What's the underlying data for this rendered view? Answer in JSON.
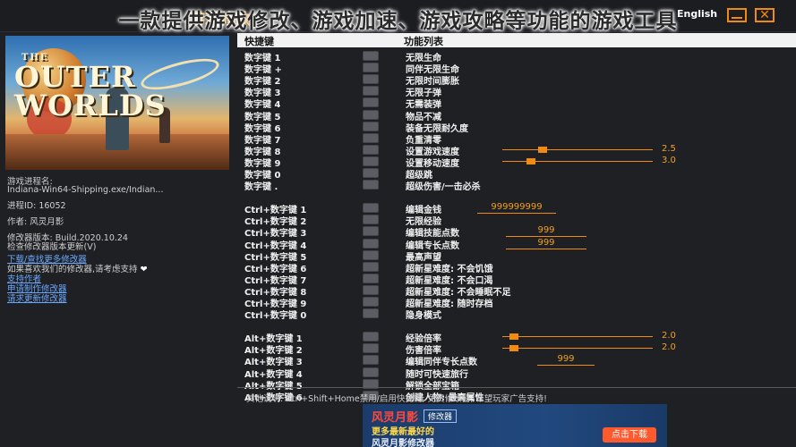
{
  "overlay_title": "一款提供游戏修改、游戏加速、游戏攻略等功能的游戏工具",
  "titlebar": {
    "app_title": "游戏修改",
    "language": "English"
  },
  "colors": {
    "accent": "#f08a10",
    "link": "#6aa9ff",
    "background": "#1f2024"
  },
  "left": {
    "cover_logo_small": "THE",
    "cover_logo_big": "OUTER WORLDS",
    "process_label": "游戏进程名:",
    "process_name": "Indiana-Win64-Shipping.exe/Indian...",
    "pid": "进程ID:  16052",
    "author": "作者:  风灵月影",
    "version": "修改器版本:  Build.2020.10.24",
    "check_update": "检查修改器版本更新(V)",
    "download_more": "下载/查找更多修改器",
    "support_text": "如果喜欢我们的修改器,请考虑支持",
    "support_link": "支持作者",
    "request": "申请制作修改器",
    "request_update": "请求更新修改器"
  },
  "table": {
    "header_key": "快捷键",
    "header_func": "功能列表",
    "rows": [
      {
        "key": "数字键 1",
        "func": "无限生命"
      },
      {
        "key": "数字键 +",
        "func": "同伴无限生命"
      },
      {
        "key": "数字键 2",
        "func": "无限时间膨胀"
      },
      {
        "key": "数字键 3",
        "func": "无限子弹"
      },
      {
        "key": "数字键 4",
        "func": "无需装弹"
      },
      {
        "key": "数字键 5",
        "func": "物品不减"
      },
      {
        "key": "数字键 6",
        "func": "装备无限耐久度"
      },
      {
        "key": "数字键 7",
        "func": "负重清零"
      },
      {
        "key": "数字键 8",
        "func": "设置游戏速度",
        "slider": 0.25,
        "value": "2.5"
      },
      {
        "key": "数字键 9",
        "func": "设置移动速度",
        "slider": 0.17,
        "value": "3.0"
      },
      {
        "key": "数字键 0",
        "func": "超级跳"
      },
      {
        "key": "数字键 .",
        "func": "超级伤害/一击必杀"
      },
      {
        "key": "Ctrl+数字键 1",
        "func": "编辑金钱",
        "edit": "999999999"
      },
      {
        "key": "Ctrl+数字键 2",
        "func": "无限经验"
      },
      {
        "key": "Ctrl+数字键 3",
        "func": "编辑技能点数",
        "edit": "999"
      },
      {
        "key": "Ctrl+数字键 4",
        "func": "编辑专长点数",
        "edit": "999"
      },
      {
        "key": "Ctrl+数字键 5",
        "func": "最高声望"
      },
      {
        "key": "Ctrl+数字键 6",
        "func": "超新星难度:  不会饥饿"
      },
      {
        "key": "Ctrl+数字键 7",
        "func": "超新星难度:  不会口渴"
      },
      {
        "key": "Ctrl+数字键 8",
        "func": "超新星难度:  不会睡眠不足"
      },
      {
        "key": "Ctrl+数字键 9",
        "func": "超新星难度:  随时存档"
      },
      {
        "key": "Ctrl+数字键 0",
        "func": "隐身模式"
      },
      {
        "key": "Alt+数字键 1",
        "func": "经验倍率",
        "slider": 0.05,
        "value": "2.0"
      },
      {
        "key": "Alt+数字键 2",
        "func": "伤害倍率",
        "slider": 0.05,
        "value": "2.0"
      },
      {
        "key": "Alt+数字键 3",
        "func": "编辑同伴专长点数",
        "edit": "999"
      },
      {
        "key": "Alt+数字键 4",
        "func": "随时可快速旅行"
      },
      {
        "key": "Alt+数字键 5",
        "func": "解锁全部宝箱"
      },
      {
        "key": "Alt+数字键 6",
        "func": "创建人物:  最高属性"
      }
    ]
  },
  "footnote": "其他说明:  Ctrl+Shift+Home禁用/启用快捷键;  免费修改器,  希望玩家广告支持!",
  "ad": {
    "logo": "风灵月影",
    "tag": "修改器",
    "line1": "更多最新最好的",
    "line2": "风灵月影修改器",
    "button": "点击下载"
  }
}
